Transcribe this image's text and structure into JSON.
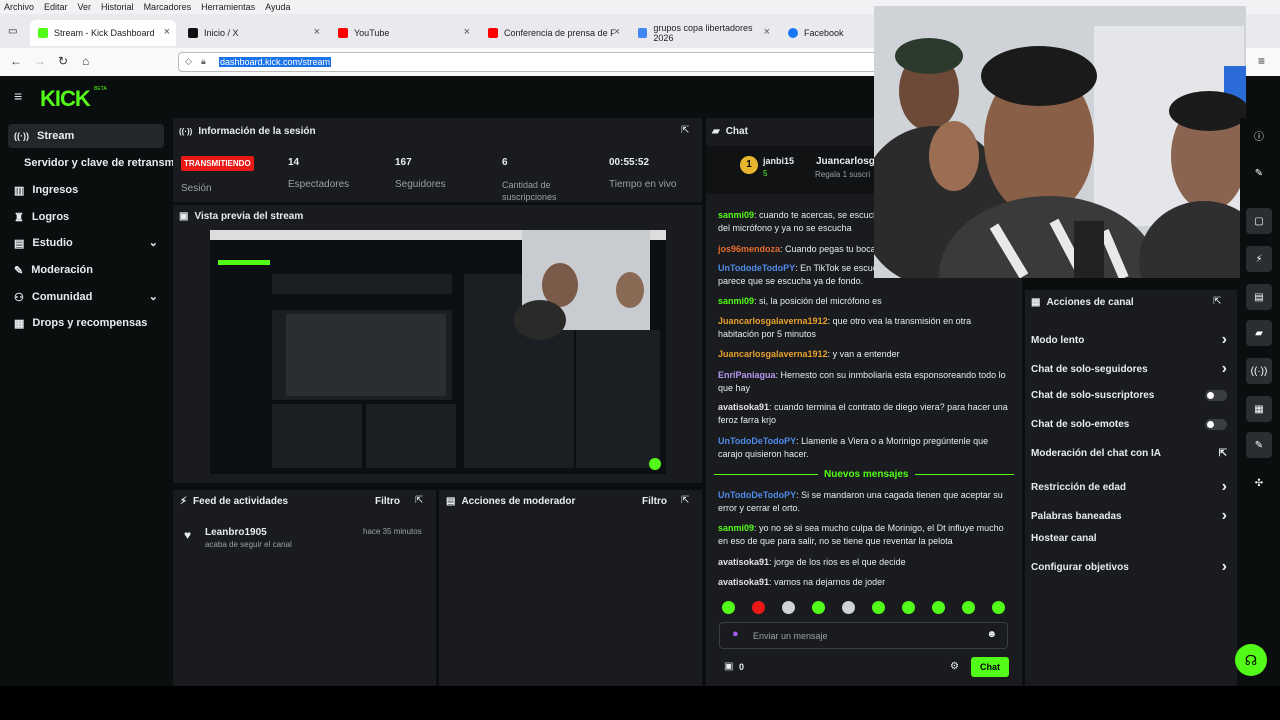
{
  "menubar": {
    "items": [
      "Archivo",
      "Editar",
      "Ver",
      "Historial",
      "Marcadores",
      "Herramientas",
      "Ayuda"
    ]
  },
  "tabs": [
    {
      "label": "Stream - Kick Dashboard",
      "color": "#53fc18"
    },
    {
      "label": "Inicio / X",
      "color": "#111111"
    },
    {
      "label": "YouTube",
      "color": "#ff0000"
    },
    {
      "label": "Conferencia de prensa de Franc",
      "color": "#ff0000"
    },
    {
      "label": "grupos copa libertadores 2026",
      "color": "#4285f4"
    },
    {
      "label": "Facebook",
      "color": "#1877f2"
    }
  ],
  "url": "dashboard.kick.com/stream",
  "brand": {
    "logo": "KICK",
    "beta": "BETA",
    "accent": "#53fc18"
  },
  "sidebar": {
    "items": [
      {
        "label": "Stream",
        "icon": "broadcast-icon"
      },
      {
        "label": "Servidor y clave de retransm",
        "icon": ""
      },
      {
        "label": "Ingresos",
        "icon": "chart-icon"
      },
      {
        "label": "Logros",
        "icon": "trophy-icon"
      },
      {
        "label": "Estudio",
        "icon": "studio-icon"
      },
      {
        "label": "Moderación",
        "icon": "wrench-icon"
      },
      {
        "label": "Comunidad",
        "icon": "community-icon"
      },
      {
        "label": "Drops y recompensas",
        "icon": "drops-icon"
      }
    ]
  },
  "session": {
    "title": "Información de la sesión",
    "badge": "TRANSMITIENDO",
    "session_label": "Sesión",
    "viewers": "14",
    "viewers_label": "Espectadores",
    "followers": "167",
    "followers_label": "Seguidores",
    "subs": "6",
    "subs_label": "Cantidad de suscripciones",
    "live_time": "00:55:52",
    "live_time_label": "Tiempo en vivo"
  },
  "preview": {
    "title": "Vista previa del stream"
  },
  "activity": {
    "title": "Feed de actividades",
    "filter": "Filtro",
    "user": "Leanbro1905",
    "text": "acaba de seguir el canal",
    "time": "hace 35 minutos"
  },
  "modactions": {
    "title": "Acciones de moderador",
    "filter": "Filtro"
  },
  "chat": {
    "title": "Chat",
    "pinned_user": "janbi15",
    "pinned_count": "5",
    "pinned_user2": "Juancarlosg",
    "pinned_text": "Regala 1 suscri",
    "new_messages": "Nuevos mensajes",
    "messages": [
      {
        "user": "sanmi09",
        "text": "cuando te acercas, se escucha mejor, pero cuando te alejas del micrófono y ya no se escucha",
        "color": "#53fc18"
      },
      {
        "user": "jos96mendoza",
        "text": "Cuando pegas tu boca",
        "color": "#e36b2c"
      },
      {
        "user": "UnTododeTodoPY",
        "text": "En TikTok se escucha mejor",
        "color": "#4f8be8"
      },
      {
        "user": "",
        "text": "parece que se escucha ya de fondo.",
        "color": ""
      },
      {
        "user": "sanmi09",
        "text": "si, la posición del micrófono es",
        "color": "#53fc18"
      },
      {
        "user": "Juancarlosgalaverna1912",
        "text": "que otro vea la transmisión en otra habitación por 5 minutos",
        "color": "#e8a12c"
      },
      {
        "user": "Juancarlosgalaverna1912",
        "text": "y van a entender",
        "color": "#e8a12c"
      },
      {
        "user": "EnriPaniagua",
        "text": "Hernesto con su inmboliaria esta esponsoreando todo lo que hay",
        "color": "#b59af0"
      },
      {
        "user": "avatisoka91",
        "text": "cuando termina el contrato de diego viera? para hacer una feroz farra krjo",
        "color": "#e2e2e2"
      },
      {
        "user": "UnTodoDeTodoPY",
        "text": "Llamenle a Viera o a Morinigo pregúntenle que carajo quisieron hacer.",
        "color": "#4f8be8"
      },
      {
        "user": "UnTodoDeTodoPY",
        "text": "Si se mandaron una cagada tienen que aceptar su error y cerrar el orto.",
        "color": "#4f8be8"
      },
      {
        "user": "sanmi09",
        "text": "yo no sé si sea mucho culpa de Morinigo, el Dt influye mucho en eso de que para salir, no se tiene que reventar la pelota",
        "color": "#53fc18"
      },
      {
        "user": "avatisoka91",
        "text": "jorge de los rios es el que decide",
        "color": "#e2e2e2"
      },
      {
        "user": "avatisoka91",
        "text": "vamos na dejarnos de joder",
        "color": "#e2e2e2"
      }
    ],
    "input_placeholder": "Enviar un mensaje",
    "points": "0",
    "send": "Chat"
  },
  "channel_actions": {
    "title": "Acciones de canal",
    "items": [
      {
        "label": "Modo lento",
        "kind": "arrow"
      },
      {
        "label": "Chat de solo-seguidores",
        "kind": "arrow"
      },
      {
        "label": "Chat de solo-suscriptores",
        "kind": "toggle"
      },
      {
        "label": "Chat de solo-emotes",
        "kind": "toggle"
      },
      {
        "label": "Moderación del chat con IA",
        "kind": "external"
      },
      {
        "label": "Restricción de edad",
        "kind": "arrow"
      },
      {
        "label": "Palabras baneadas",
        "kind": "arrow"
      },
      {
        "label": "Hostear canal",
        "kind": "none"
      },
      {
        "label": "Configurar objetivos",
        "kind": "arrow"
      }
    ]
  }
}
